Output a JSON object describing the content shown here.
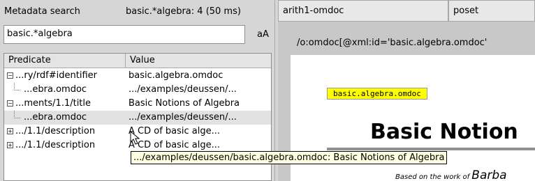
{
  "panel_left": {
    "title": "Metadata search",
    "status": "basic.*algebra: 4 (50 ms)",
    "search": {
      "value": "basic.*algebra",
      "case_toggle": "aA"
    },
    "columns": {
      "predicate": "Predicate",
      "value": "Value"
    },
    "rows": [
      {
        "predicate": "...ry/rdf#identifier",
        "value": "basic.algebra.omdoc",
        "expander": "minus",
        "level": 0
      },
      {
        "predicate": "...ebra.omdoc",
        "value": ".../examples/deussen/...",
        "level": 1
      },
      {
        "predicate": "...ments/1.1/title",
        "value": "Basic Notions of Algebra",
        "expander": "minus",
        "level": 0
      },
      {
        "predicate": "...ebra.omdoc",
        "value": ".../examples/deussen/...",
        "level": 1,
        "selected": true
      },
      {
        "predicate": ".../1.1/description",
        "value": "A CD of basic alge...",
        "expander": "plus",
        "level": 0
      },
      {
        "predicate": ".../1.1/description",
        "value": "A CD of basic alge...",
        "expander": "plus",
        "level": 0
      }
    ],
    "tooltip": ".../examples/deussen/basic.algebra.omdoc: Basic Notions of Algebra",
    "expander_glyphs": {
      "minus": "−",
      "plus": "+"
    }
  },
  "panel_right": {
    "tabs": [
      "arith1-omdoc",
      "poset"
    ],
    "xpath": "/o:omdoc[@xml:id='basic.algebra.omdoc'",
    "doc": {
      "badge": "basic.algebra.omdoc",
      "title": "Basic Notion",
      "based_prefix": "Based on the work of ",
      "based_name": "Barba"
    }
  },
  "colors": {
    "highlight": "#ffff00",
    "tooltip_bg": "#ffffe1",
    "panel_bg": "#d6d6d6"
  }
}
